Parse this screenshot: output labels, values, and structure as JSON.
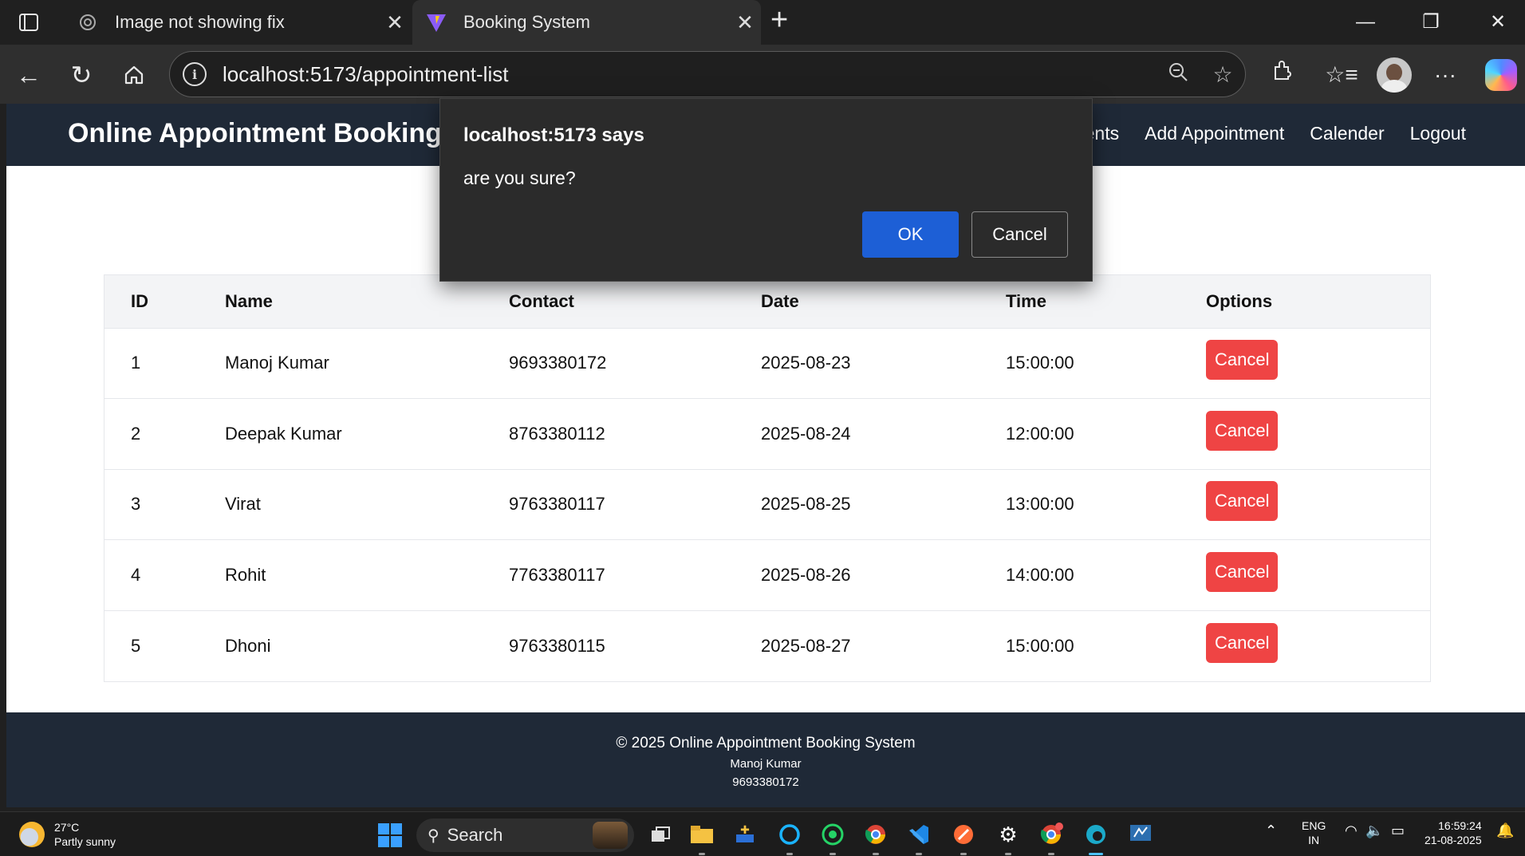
{
  "browser": {
    "tabs": [
      {
        "title": "Image not showing fix",
        "icon": "openai-icon",
        "active": false
      },
      {
        "title": "Booking System",
        "icon": "vite-icon",
        "active": true
      }
    ],
    "address_url": "localhost:5173/appointment-list"
  },
  "site": {
    "brand": "Online Appointment Booking S",
    "nav": [
      "ents",
      "Add Appointment",
      "Calender",
      "Logout"
    ],
    "table": {
      "headers": [
        "ID",
        "Name",
        "Contact",
        "Date",
        "Time",
        "Options"
      ],
      "rows": [
        {
          "id": "1",
          "name": "Manoj Kumar",
          "contact": "9693380172",
          "date": "2025-08-23",
          "time": "15:00:00",
          "action": "Cancel"
        },
        {
          "id": "2",
          "name": "Deepak Kumar",
          "contact": "8763380112",
          "date": "2025-08-24",
          "time": "12:00:00",
          "action": "Cancel"
        },
        {
          "id": "3",
          "name": "Virat",
          "contact": "9763380117",
          "date": "2025-08-25",
          "time": "13:00:00",
          "action": "Cancel"
        },
        {
          "id": "4",
          "name": "Rohit",
          "contact": "7763380117",
          "date": "2025-08-26",
          "time": "14:00:00",
          "action": "Cancel"
        },
        {
          "id": "5",
          "name": "Dhoni",
          "contact": "9763380115",
          "date": "2025-08-27",
          "time": "15:00:00",
          "action": "Cancel"
        }
      ]
    },
    "footer": {
      "copyright": "© 2025 Online Appointment Booking System",
      "name": "Manoj Kumar",
      "phone": "9693380172"
    }
  },
  "dialog": {
    "title": "localhost:5173 says",
    "message": "are you sure?",
    "ok_label": "OK",
    "cancel_label": "Cancel"
  },
  "taskbar": {
    "weather_temp": "27°C",
    "weather_desc": "Partly sunny",
    "search_label": "Search",
    "lang_top": "ENG",
    "lang_bottom": "IN",
    "time": "16:59:24",
    "date": "21-08-2025"
  },
  "colors": {
    "nav_bg": "#1f2937",
    "cancel_red": "#ef4444",
    "ok_blue": "#1d5fd6"
  }
}
